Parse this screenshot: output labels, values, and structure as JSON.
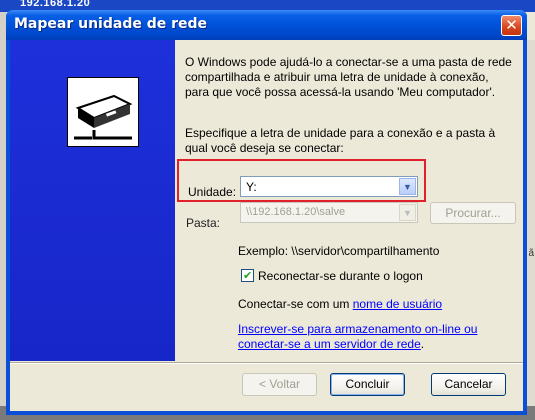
{
  "background": {
    "title": "192.168.1.20",
    "side_label": "ã"
  },
  "dialog": {
    "title": "Mapear unidade de rede",
    "close_label": "✕",
    "description": "O Windows pode ajudá-lo a conectar-se a uma pasta de rede compartilhada e atribuir uma letra de unidade à conexão, para que você possa acessá-la usando 'Meu computador'.",
    "instruction": "Especifique a letra de unidade para a conexão e a pasta à qual você deseja se conectar:",
    "drive": {
      "label": "Unidade:",
      "value": "Y:"
    },
    "folder": {
      "label": "Pasta:",
      "value": "\\\\192.168.1.20\\salve",
      "browse_label": "Procurar..."
    },
    "example": "Exemplo: \\\\servidor\\compartilhamento",
    "reconnect": {
      "label": "Reconectar-se durante o logon",
      "checked": true
    },
    "connect_as": {
      "prefix": "Conectar-se com um",
      "link": "nome de usuário"
    },
    "online_link_line1": "Inscrever-se para armazenamento on-line ou",
    "online_link_line2": "conectar-se a um servidor de rede",
    "online_suffix": ".",
    "buttons": {
      "back": "< Voltar",
      "finish": "Concluir",
      "cancel": "Cancelar"
    },
    "colors": {
      "highlight": "#e0212b",
      "title_bar": "#0050d8",
      "link": "#0000ff"
    }
  }
}
